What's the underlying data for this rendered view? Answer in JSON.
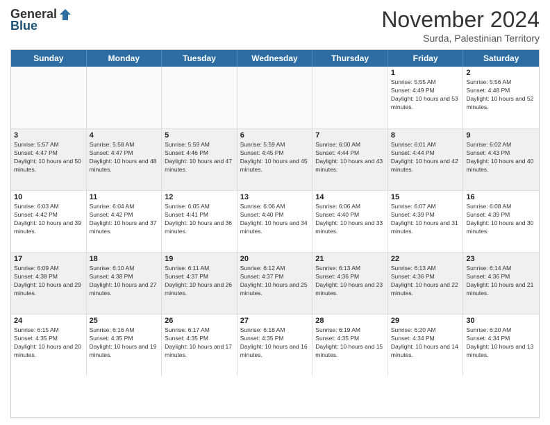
{
  "header": {
    "logo_general": "General",
    "logo_blue": "Blue",
    "month_title": "November 2024",
    "subtitle": "Surda, Palestinian Territory"
  },
  "days_of_week": [
    "Sunday",
    "Monday",
    "Tuesday",
    "Wednesday",
    "Thursday",
    "Friday",
    "Saturday"
  ],
  "weeks": [
    [
      {
        "day": "",
        "empty": true
      },
      {
        "day": "",
        "empty": true
      },
      {
        "day": "",
        "empty": true
      },
      {
        "day": "",
        "empty": true
      },
      {
        "day": "",
        "empty": true
      },
      {
        "day": "1",
        "sunrise": "Sunrise: 5:55 AM",
        "sunset": "Sunset: 4:49 PM",
        "daylight": "Daylight: 10 hours and 53 minutes."
      },
      {
        "day": "2",
        "sunrise": "Sunrise: 5:56 AM",
        "sunset": "Sunset: 4:48 PM",
        "daylight": "Daylight: 10 hours and 52 minutes."
      }
    ],
    [
      {
        "day": "3",
        "sunrise": "Sunrise: 5:57 AM",
        "sunset": "Sunset: 4:47 PM",
        "daylight": "Daylight: 10 hours and 50 minutes."
      },
      {
        "day": "4",
        "sunrise": "Sunrise: 5:58 AM",
        "sunset": "Sunset: 4:47 PM",
        "daylight": "Daylight: 10 hours and 48 minutes."
      },
      {
        "day": "5",
        "sunrise": "Sunrise: 5:59 AM",
        "sunset": "Sunset: 4:46 PM",
        "daylight": "Daylight: 10 hours and 47 minutes."
      },
      {
        "day": "6",
        "sunrise": "Sunrise: 5:59 AM",
        "sunset": "Sunset: 4:45 PM",
        "daylight": "Daylight: 10 hours and 45 minutes."
      },
      {
        "day": "7",
        "sunrise": "Sunrise: 6:00 AM",
        "sunset": "Sunset: 4:44 PM",
        "daylight": "Daylight: 10 hours and 43 minutes."
      },
      {
        "day": "8",
        "sunrise": "Sunrise: 6:01 AM",
        "sunset": "Sunset: 4:44 PM",
        "daylight": "Daylight: 10 hours and 42 minutes."
      },
      {
        "day": "9",
        "sunrise": "Sunrise: 6:02 AM",
        "sunset": "Sunset: 4:43 PM",
        "daylight": "Daylight: 10 hours and 40 minutes."
      }
    ],
    [
      {
        "day": "10",
        "sunrise": "Sunrise: 6:03 AM",
        "sunset": "Sunset: 4:42 PM",
        "daylight": "Daylight: 10 hours and 39 minutes."
      },
      {
        "day": "11",
        "sunrise": "Sunrise: 6:04 AM",
        "sunset": "Sunset: 4:42 PM",
        "daylight": "Daylight: 10 hours and 37 minutes."
      },
      {
        "day": "12",
        "sunrise": "Sunrise: 6:05 AM",
        "sunset": "Sunset: 4:41 PM",
        "daylight": "Daylight: 10 hours and 36 minutes."
      },
      {
        "day": "13",
        "sunrise": "Sunrise: 6:06 AM",
        "sunset": "Sunset: 4:40 PM",
        "daylight": "Daylight: 10 hours and 34 minutes."
      },
      {
        "day": "14",
        "sunrise": "Sunrise: 6:06 AM",
        "sunset": "Sunset: 4:40 PM",
        "daylight": "Daylight: 10 hours and 33 minutes."
      },
      {
        "day": "15",
        "sunrise": "Sunrise: 6:07 AM",
        "sunset": "Sunset: 4:39 PM",
        "daylight": "Daylight: 10 hours and 31 minutes."
      },
      {
        "day": "16",
        "sunrise": "Sunrise: 6:08 AM",
        "sunset": "Sunset: 4:39 PM",
        "daylight": "Daylight: 10 hours and 30 minutes."
      }
    ],
    [
      {
        "day": "17",
        "sunrise": "Sunrise: 6:09 AM",
        "sunset": "Sunset: 4:38 PM",
        "daylight": "Daylight: 10 hours and 29 minutes."
      },
      {
        "day": "18",
        "sunrise": "Sunrise: 6:10 AM",
        "sunset": "Sunset: 4:38 PM",
        "daylight": "Daylight: 10 hours and 27 minutes."
      },
      {
        "day": "19",
        "sunrise": "Sunrise: 6:11 AM",
        "sunset": "Sunset: 4:37 PM",
        "daylight": "Daylight: 10 hours and 26 minutes."
      },
      {
        "day": "20",
        "sunrise": "Sunrise: 6:12 AM",
        "sunset": "Sunset: 4:37 PM",
        "daylight": "Daylight: 10 hours and 25 minutes."
      },
      {
        "day": "21",
        "sunrise": "Sunrise: 6:13 AM",
        "sunset": "Sunset: 4:36 PM",
        "daylight": "Daylight: 10 hours and 23 minutes."
      },
      {
        "day": "22",
        "sunrise": "Sunrise: 6:13 AM",
        "sunset": "Sunset: 4:36 PM",
        "daylight": "Daylight: 10 hours and 22 minutes."
      },
      {
        "day": "23",
        "sunrise": "Sunrise: 6:14 AM",
        "sunset": "Sunset: 4:36 PM",
        "daylight": "Daylight: 10 hours and 21 minutes."
      }
    ],
    [
      {
        "day": "24",
        "sunrise": "Sunrise: 6:15 AM",
        "sunset": "Sunset: 4:35 PM",
        "daylight": "Daylight: 10 hours and 20 minutes."
      },
      {
        "day": "25",
        "sunrise": "Sunrise: 6:16 AM",
        "sunset": "Sunset: 4:35 PM",
        "daylight": "Daylight: 10 hours and 19 minutes."
      },
      {
        "day": "26",
        "sunrise": "Sunrise: 6:17 AM",
        "sunset": "Sunset: 4:35 PM",
        "daylight": "Daylight: 10 hours and 17 minutes."
      },
      {
        "day": "27",
        "sunrise": "Sunrise: 6:18 AM",
        "sunset": "Sunset: 4:35 PM",
        "daylight": "Daylight: 10 hours and 16 minutes."
      },
      {
        "day": "28",
        "sunrise": "Sunrise: 6:19 AM",
        "sunset": "Sunset: 4:35 PM",
        "daylight": "Daylight: 10 hours and 15 minutes."
      },
      {
        "day": "29",
        "sunrise": "Sunrise: 6:20 AM",
        "sunset": "Sunset: 4:34 PM",
        "daylight": "Daylight: 10 hours and 14 minutes."
      },
      {
        "day": "30",
        "sunrise": "Sunrise: 6:20 AM",
        "sunset": "Sunset: 4:34 PM",
        "daylight": "Daylight: 10 hours and 13 minutes."
      }
    ]
  ]
}
